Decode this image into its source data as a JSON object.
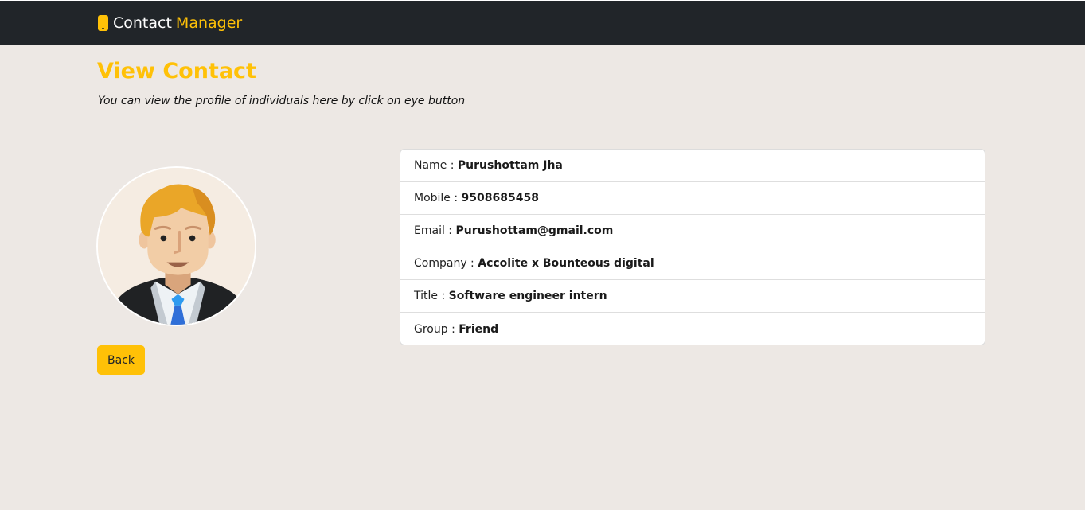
{
  "navbar": {
    "brand_main": "Contact",
    "brand_accent": "Manager",
    "brand_icon": "mobile-phone-icon"
  },
  "page": {
    "title": "View Contact",
    "subtitle": "You can view the profile of individuals here by click on eye button"
  },
  "profile": {
    "avatar_icon": "male-avatar-icon",
    "back_label": "Back"
  },
  "details": [
    {
      "label": "Name : ",
      "value": "Purushottam Jha"
    },
    {
      "label": "Mobile : ",
      "value": "9508685458"
    },
    {
      "label": "Email : ",
      "value": "Purushottam@gmail.com"
    },
    {
      "label": "Company : ",
      "value": "Accolite x Bounteous digital"
    },
    {
      "label": "Title : ",
      "value": "Software engineer intern"
    },
    {
      "label": "Group : ",
      "value": "Friend"
    }
  ],
  "colors": {
    "accent": "#ffc107",
    "navbar_bg": "#212529",
    "page_bg": "#ede8e4"
  }
}
